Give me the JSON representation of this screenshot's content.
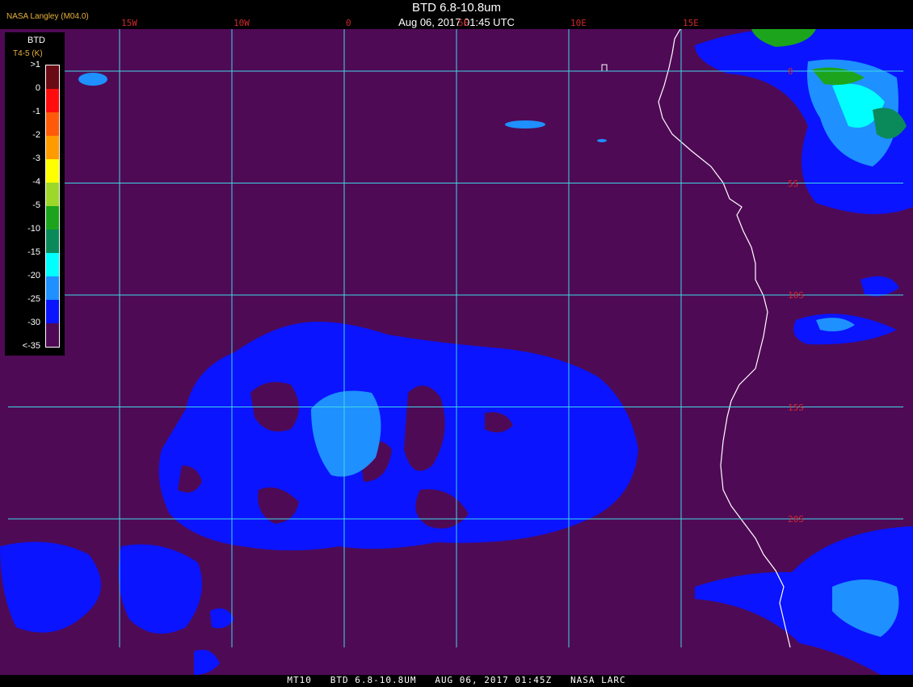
{
  "header": {
    "credit": "NASA Langley (M04.0)",
    "title": "BTD 6.8-10.8um",
    "subtitle": "Aug 06, 2017 01:45 UTC"
  },
  "grid": {
    "longitudes": [
      {
        "label": "15W",
        "value": -15
      },
      {
        "label": "10W",
        "value": -10
      },
      {
        "label": "0",
        "value": -5
      },
      {
        "label": "5E",
        "value": 0
      },
      {
        "label": "10E",
        "value": 5
      },
      {
        "label": "15E",
        "value": 10
      }
    ],
    "latitudes": [
      {
        "label": "0",
        "value": 0
      },
      {
        "label": "5S",
        "value": -5
      },
      {
        "label": "10S",
        "value": -10
      },
      {
        "label": "15S",
        "value": -15
      },
      {
        "label": "20S",
        "value": -20
      }
    ]
  },
  "legend": {
    "title": "BTD",
    "subtitle": "T4-5 (K)",
    "items": [
      {
        "label": ">1",
        "color": "#6a0a14"
      },
      {
        "label": "0",
        "color": "#ff0d0d"
      },
      {
        "label": "-1",
        "color": "#ff5a0a"
      },
      {
        "label": "-2",
        "color": "#ff9a00"
      },
      {
        "label": "-3",
        "color": "#ffff00"
      },
      {
        "label": "-4",
        "color": "#9cd72a"
      },
      {
        "label": "-5",
        "color": "#1ca51c"
      },
      {
        "label": "-10",
        "color": "#0a8a5a"
      },
      {
        "label": "-15",
        "color": "#00ffff"
      },
      {
        "label": "-20",
        "color": "#1e90ff"
      },
      {
        "label": "-25",
        "color": "#0a14ff"
      },
      {
        "label": "-30",
        "color": "#4f0a55"
      },
      {
        "label": "<-35",
        "color": null
      }
    ]
  },
  "colors": {
    "background": "#4f0a55",
    "cloud_blue": "#0a14ff",
    "cloud_light": "#1e90ff",
    "grid": "#3fd8e6",
    "coast": "#ffffff"
  },
  "footer": {
    "text": "MT10   BTD 6.8-10.8UM   AUG 06, 2017 01:45Z   NASA LARC"
  }
}
